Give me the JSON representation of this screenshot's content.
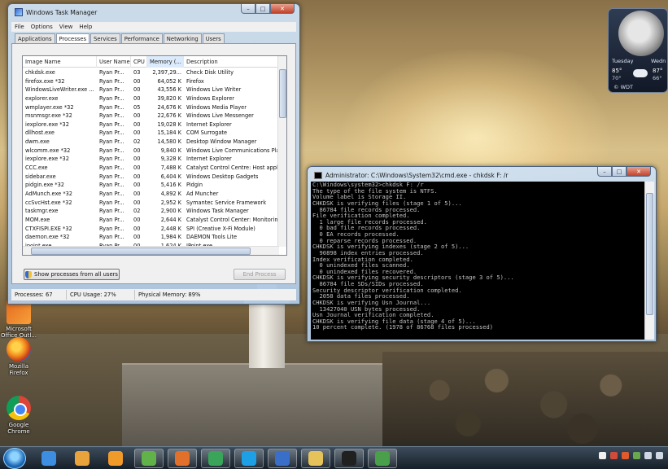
{
  "desktop": {
    "icons": [
      {
        "label": "Microsoft Office Outl...",
        "name": "office"
      },
      {
        "label": "Mozilla Firefox",
        "name": "firefox"
      },
      {
        "label": "Google Chrome",
        "name": "chrome"
      }
    ]
  },
  "weather": {
    "day1": "Tuesday",
    "day2": "Wedn",
    "hi1": "85°",
    "lo1": "70°",
    "hi2": "87°",
    "lo2": "66°",
    "source": "© WDT"
  },
  "task_manager": {
    "title": "Windows Task Manager",
    "menu": [
      "File",
      "Options",
      "View",
      "Help"
    ],
    "tabs": [
      "Applications",
      "Processes",
      "Services",
      "Performance",
      "Networking",
      "Users"
    ],
    "active_tab": "Processes",
    "columns": [
      "Image Name",
      "User Name",
      "CPU",
      "Memory (...",
      "Description"
    ],
    "processes": [
      [
        "chkdsk.exe",
        "Ryan Pr...",
        "03",
        "2,397,29...",
        "Check Disk Utility"
      ],
      [
        "firefox.exe *32",
        "Ryan Pr...",
        "00",
        "64,052 K",
        "Firefox"
      ],
      [
        "WindowsLiveWriter.exe ...",
        "Ryan Pr...",
        "00",
        "43,556 K",
        "Windows Live Writer"
      ],
      [
        "explorer.exe",
        "Ryan Pr...",
        "00",
        "39,820 K",
        "Windows Explorer"
      ],
      [
        "wmplayer.exe *32",
        "Ryan Pr...",
        "05",
        "24,676 K",
        "Windows Media Player"
      ],
      [
        "msnmsgr.exe *32",
        "Ryan Pr...",
        "00",
        "22,676 K",
        "Windows Live Messenger"
      ],
      [
        "iexplore.exe *32",
        "Ryan Pr...",
        "00",
        "19,028 K",
        "Internet Explorer"
      ],
      [
        "dllhost.exe",
        "Ryan Pr...",
        "00",
        "15,184 K",
        "COM Surrogate"
      ],
      [
        "dwm.exe",
        "Ryan Pr...",
        "02",
        "14,580 K",
        "Desktop Window Manager"
      ],
      [
        "wlcomm.exe *32",
        "Ryan Pr...",
        "00",
        "9,840 K",
        "Windows Live Communications Platfo"
      ],
      [
        "iexplore.exe *32",
        "Ryan Pr...",
        "00",
        "9,328 K",
        "Internet Explorer"
      ],
      [
        "CCC.exe",
        "Ryan Pr...",
        "00",
        "7,488 K",
        "Catalyst Control Centre: Host applic"
      ],
      [
        "sidebar.exe",
        "Ryan Pr...",
        "00",
        "6,404 K",
        "Windows Desktop Gadgets"
      ],
      [
        "pidgin.exe *32",
        "Ryan Pr...",
        "00",
        "5,416 K",
        "Pidgin"
      ],
      [
        "AdMunch.exe *32",
        "Ryan Pr...",
        "00",
        "4,892 K",
        "Ad Muncher"
      ],
      [
        "ccSvcHst.exe *32",
        "Ryan Pr...",
        "00",
        "2,952 K",
        "Symantec Service Framework"
      ],
      [
        "taskmgr.exe",
        "Ryan Pr...",
        "02",
        "2,900 K",
        "Windows Task Manager"
      ],
      [
        "MOM.exe",
        "Ryan Pr...",
        "00",
        "2,644 K",
        "Catalyst Control Center: Monitoring"
      ],
      [
        "CTXFISPI.EXE *32",
        "Ryan Pr...",
        "00",
        "2,448 K",
        "SPI (Creative X-Fi Module)"
      ],
      [
        "daemon.exe *32",
        "Ryan Pr...",
        "00",
        "1,984 K",
        "DAEMON Tools Lite"
      ],
      [
        "ipoint.exe",
        "Ryan Pr...",
        "00",
        "1,624 K",
        "IPoint.exe"
      ]
    ],
    "show_all_button": "Show processes from all users",
    "end_process_button": "End Process",
    "status": {
      "processes": "Processes: 67",
      "cpu": "CPU Usage: 27%",
      "memory": "Physical Memory: 89%"
    }
  },
  "cmd": {
    "title": "Administrator: C:\\Windows\\System32\\cmd.exe - chkdsk  F: /r",
    "lines": [
      "C:\\Windows\\system32>chkdsk F: /r",
      "The type of the file system is NTFS.",
      "Volume label is Storage II.",
      "",
      "CHKDSK is verifying files (stage 1 of 5)...",
      "  86784 file records processed.",
      "File verification completed.",
      "  1 large file records processed.",
      "  0 bad file records processed.",
      "  0 EA records processed.",
      "  0 reparse records processed.",
      "CHKDSK is verifying indexes (stage 2 of 5)...",
      "  90898 index entries processed.",
      "Index verification completed.",
      "  0 unindexed files scanned.",
      "  0 unindexed files recovered.",
      "CHKDSK is verifying security descriptors (stage 3 of 5)...",
      "  86784 file SDs/SIDs processed.",
      "Security descriptor verification completed.",
      "  2058 data files processed.",
      "CHKDSK is verifying Usn Journal...",
      "  13427040 USN bytes processed.",
      "Usn Journal verification completed.",
      "CHKDSK is verifying file data (stage 4 of 5)...",
      "10 percent complete. (1978 of 86768 files processed)"
    ]
  },
  "taskbar": {
    "buttons": [
      "ie",
      "outlook",
      "media-player",
      "live-messenger",
      "firefox",
      "chrome",
      "skype",
      "live-writer",
      "explorer",
      "cmd",
      "task-manager"
    ]
  },
  "colors": {
    "console_bg": "#000000",
    "console_text": "#c0c0c0",
    "sorted_header": "#dcebfc",
    "close_button": "#c0422a"
  }
}
